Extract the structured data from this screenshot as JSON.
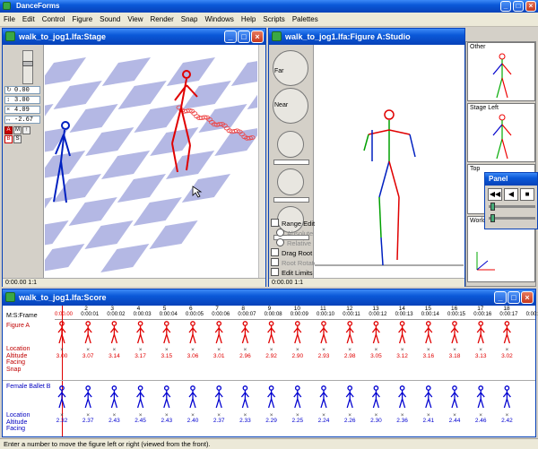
{
  "app": {
    "title": "DanceForms"
  },
  "menu": [
    "File",
    "Edit",
    "Control",
    "Figure",
    "Sound",
    "View",
    "Render",
    "Snap",
    "Windows",
    "Help",
    "Scripts",
    "Palettes"
  ],
  "stage": {
    "title": "walk_to_jog1.lfa:Stage",
    "fields": [
      "0.00",
      "3.00",
      "4.09",
      "-2.67"
    ],
    "status": "0:00.00 1:1"
  },
  "studio": {
    "title": "walk_to_jog1.lfa:Figure A:Studio",
    "far_label": "Far",
    "near_label": "Near",
    "checkboxes": [
      {
        "label": "Range Edit",
        "type": "check",
        "disabled": false
      },
      {
        "label": "Absolute",
        "type": "radio",
        "disabled": true
      },
      {
        "label": "Relative",
        "type": "radio",
        "disabled": true
      },
      {
        "label": "Drag Root",
        "type": "check",
        "disabled": false
      },
      {
        "label": "Root Rotate",
        "type": "check",
        "disabled": true
      },
      {
        "label": "Edit Limits",
        "type": "check",
        "disabled": false
      }
    ],
    "status": "0:00.00 1:1",
    "views": [
      "Other",
      "Stage Left",
      "Top",
      "World"
    ]
  },
  "panel": {
    "title": "Panel"
  },
  "score": {
    "title": "walk_to_jog1.lfa:Score",
    "frame_label": "M:S:Frame",
    "frame_numbers": [
      "1",
      "2",
      "3",
      "4",
      "5",
      "6",
      "7",
      "8",
      "9",
      "10",
      "11",
      "12",
      "13",
      "14",
      "15",
      "16",
      "17",
      "18"
    ],
    "times": [
      "0:00.00",
      "0:00:01",
      "0:00:02",
      "0:00:03",
      "0:00:04",
      "0:00:05",
      "0:00:06",
      "0:00:07",
      "0:00:08",
      "0:00:09",
      "0:00:10",
      "0:00:11",
      "0:00:12",
      "0:00:13",
      "0:00:14",
      "0:00:15",
      "0:00:16",
      "0:00:17",
      "0:00:18"
    ],
    "figure_a": {
      "name": "Figure A",
      "labels": [
        "Location",
        "Altitude",
        "Facing",
        "Snap"
      ],
      "altitudes": [
        "3.00",
        "3.07",
        "3.14",
        "3.17",
        "3.15",
        "3.06",
        "3.01",
        "2.96",
        "2.92",
        "2.90",
        "2.93",
        "2.98",
        "3.05",
        "3.12",
        "3.16",
        "3.18",
        "3.13",
        "3.02"
      ],
      "color": "#e00000"
    },
    "female_b": {
      "name": "Female Ballet B",
      "labels": [
        "Location",
        "Altitude",
        "Facing"
      ],
      "altitudes": [
        "2.32",
        "2.37",
        "2.43",
        "2.45",
        "2.43",
        "2.40",
        "2.37",
        "2.33",
        "2.29",
        "2.25",
        "2.24",
        "2.26",
        "2.30",
        "2.36",
        "2.41",
        "2.44",
        "2.46",
        "2.42",
        "2.33"
      ],
      "color": "#0000d0"
    }
  },
  "statusbar": {
    "text": "Enter a number to move the figure left or right (viewed from the front)."
  }
}
